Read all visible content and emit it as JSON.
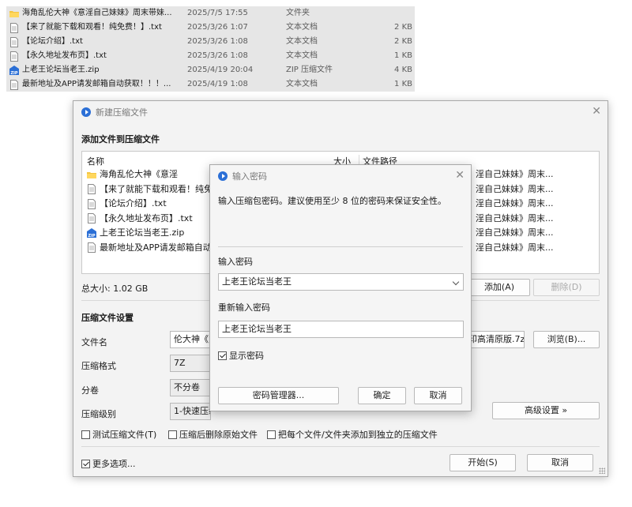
{
  "explorer": {
    "rows": [
      {
        "icon": "folder",
        "name": "海角乱伦大神《意淫自己妹妹》周末带妹...",
        "date": "2025/7/5 17:55",
        "type": "文件夹",
        "size": ""
      },
      {
        "icon": "text",
        "name": "【来了就能下载和观看！纯免费！】.txt",
        "date": "2025/3/26 1:07",
        "type": "文本文档",
        "size": "2 KB"
      },
      {
        "icon": "text",
        "name": "【论坛介绍】.txt",
        "date": "2025/3/26 1:08",
        "type": "文本文档",
        "size": "2 KB"
      },
      {
        "icon": "text",
        "name": "【永久地址发布页】.txt",
        "date": "2025/3/26 1:08",
        "type": "文本文档",
        "size": "1 KB"
      },
      {
        "icon": "zip",
        "name": "上老王论坛当老王.zip",
        "date": "2025/4/19 20:04",
        "type": "ZIP 压缩文件",
        "size": "4 KB"
      },
      {
        "icon": "text",
        "name": "最新地址及APP请发邮箱自动获取！！！...",
        "date": "2025/4/19 1:08",
        "type": "文本文档",
        "size": "1 KB"
      }
    ]
  },
  "archive_dialog": {
    "title": "新建压缩文件",
    "section_add": "添加文件到压缩文件",
    "col_name": "名称",
    "col_size": "大小",
    "col_path": "文件路径",
    "files": [
      {
        "icon": "folder",
        "name": "海角乱伦大神《意淫",
        "path": "淫自己妹妹》周末..."
      },
      {
        "icon": "text",
        "name": "【来了就能下载和观看！纯免费",
        "path": "淫自己妹妹》周末..."
      },
      {
        "icon": "text",
        "name": "【论坛介绍】.txt",
        "path": "淫自己妹妹》周末..."
      },
      {
        "icon": "text",
        "name": "【永久地址发布页】.txt",
        "path": "淫自己妹妹》周末..."
      },
      {
        "icon": "zip",
        "name": "上老王论坛当老王.zip",
        "path": "淫自己妹妹》周末..."
      },
      {
        "icon": "text",
        "name": "最新地址及APP请发邮箱自动获",
        "path": "淫自己妹妹》周末..."
      }
    ],
    "total_size": "总大小: 1.02 GB",
    "add_button": "添加(A)",
    "delete_button": "删除(D)",
    "section_settings": "压缩文件设置",
    "label_filename": "文件名",
    "filename_value": "伦大神《意",
    "filename_tail": "印高清原版.7z",
    "browse_button": "浏览(B)...",
    "label_format": "压缩格式",
    "format_value": "7Z",
    "label_volume": "分卷",
    "volume_value": "不分卷",
    "label_level": "压缩级别",
    "level_value": "1-快速压缩",
    "advanced_button": "高级设置 »",
    "test_checkbox": "测试压缩文件(T)",
    "delete_source_checkbox": "压缩后删除原始文件",
    "separate_checkbox": "把每个文件/文件夹添加到独立的压缩文件",
    "more_options_checkbox": "更多选项...",
    "start_button": "开始(S)",
    "cancel_button": "取消"
  },
  "password_dialog": {
    "title": "输入密码",
    "hint": "输入压缩包密码。建议使用至少 8 位的密码来保证安全性。",
    "label_password": "输入密码",
    "password_value": "上老王论坛当老王",
    "label_repeat": "重新输入密码",
    "repeat_value": "上老王论坛当老王",
    "show_password": "显示密码",
    "manager_button": "密码管理器...",
    "ok_button": "确定",
    "cancel_button": "取消"
  }
}
